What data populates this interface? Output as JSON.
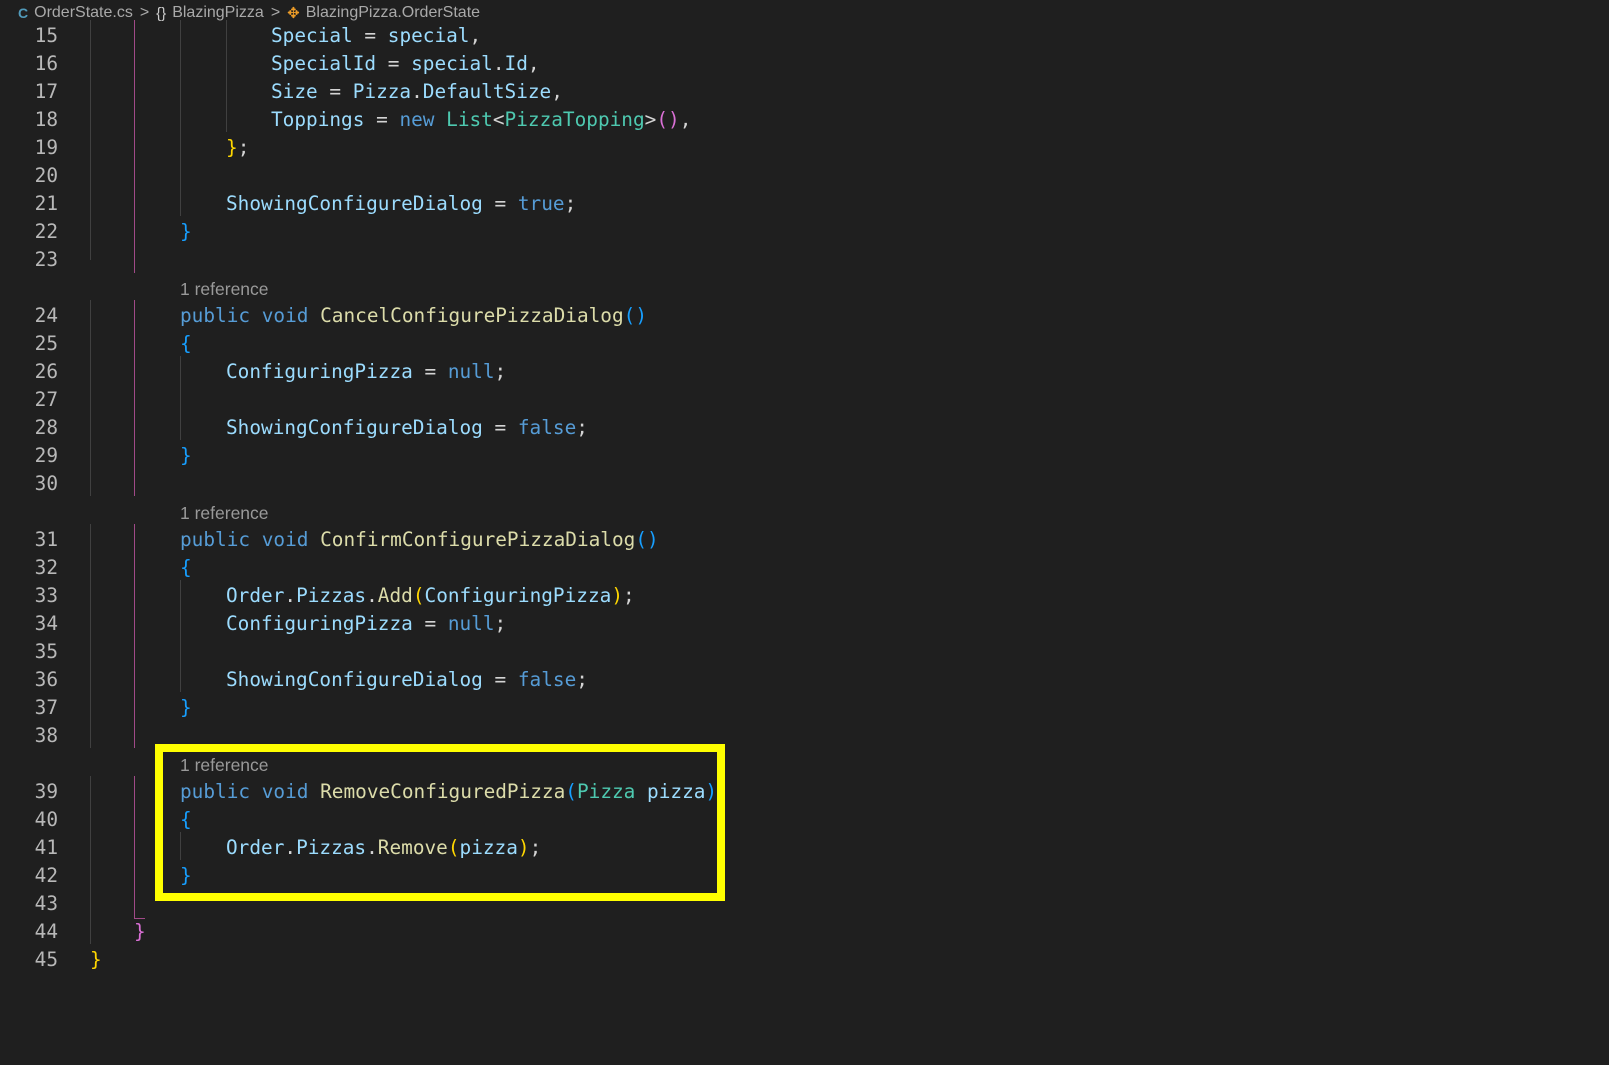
{
  "breadcrumb": {
    "file": "OrderState.cs",
    "namespace": "BlazingPizza",
    "class": "BlazingPizza.OrderState",
    "separator": ">",
    "file_icon": "csharp-file-icon",
    "namespace_icon": "namespace-braces-icon",
    "class_icon": "class-icon"
  },
  "colors": {
    "background": "#1f1f1f",
    "keyword": "#569cd6",
    "property": "#9cdcfe",
    "method": "#dcdcaa",
    "type": "#4ec9b0",
    "bracket_level1": "#ffd700",
    "bracket_level2": "#da70d6",
    "bracket_level3": "#179fff",
    "highlight_box": "#ffff00"
  },
  "code_lens": [
    "1 reference",
    "1 reference",
    "1 reference"
  ],
  "lines": [
    {
      "n": "15",
      "tokens": [
        [
          "prop",
          "Special"
        ],
        [
          "punc",
          " = "
        ],
        [
          "var",
          "special"
        ],
        [
          "punc",
          ","
        ]
      ]
    },
    {
      "n": "16",
      "tokens": [
        [
          "prop",
          "SpecialId"
        ],
        [
          "punc",
          " = "
        ],
        [
          "var",
          "special"
        ],
        [
          "punc",
          "."
        ],
        [
          "prop",
          "Id"
        ],
        [
          "punc",
          ","
        ]
      ]
    },
    {
      "n": "17",
      "tokens": [
        [
          "prop",
          "Size"
        ],
        [
          "punc",
          " = "
        ],
        [
          "prop",
          "Pizza"
        ],
        [
          "punc",
          "."
        ],
        [
          "prop",
          "DefaultSize"
        ],
        [
          "punc",
          ","
        ]
      ]
    },
    {
      "n": "18",
      "tokens": [
        [
          "prop",
          "Toppings"
        ],
        [
          "punc",
          " = "
        ],
        [
          "kw",
          "new"
        ],
        [
          "punc",
          " "
        ],
        [
          "type",
          "List"
        ],
        [
          "punc",
          "<"
        ],
        [
          "type",
          "PizzaTopping"
        ],
        [
          "punc",
          ">"
        ],
        [
          "b2",
          "()"
        ],
        [
          "punc",
          ","
        ]
      ]
    },
    {
      "n": "19",
      "tokens": [
        [
          "b1",
          "}"
        ],
        [
          "punc",
          ";"
        ]
      ]
    },
    {
      "n": "20",
      "tokens": []
    },
    {
      "n": "21",
      "tokens": [
        [
          "prop",
          "ShowingConfigureDialog"
        ],
        [
          "punc",
          " = "
        ],
        [
          "kw",
          "true"
        ],
        [
          "punc",
          ";"
        ]
      ]
    },
    {
      "n": "22",
      "tokens": [
        [
          "b3",
          "}"
        ]
      ]
    },
    {
      "n": "23",
      "tokens": []
    },
    {
      "n": "24",
      "tokens": [
        [
          "kw",
          "public"
        ],
        [
          "punc",
          " "
        ],
        [
          "kw",
          "void"
        ],
        [
          "punc",
          " "
        ],
        [
          "method",
          "CancelConfigurePizzaDialog"
        ],
        [
          "b3",
          "()"
        ]
      ]
    },
    {
      "n": "25",
      "tokens": [
        [
          "b3",
          "{"
        ]
      ]
    },
    {
      "n": "26",
      "tokens": [
        [
          "prop",
          "ConfiguringPizza"
        ],
        [
          "punc",
          " = "
        ],
        [
          "kw",
          "null"
        ],
        [
          "punc",
          ";"
        ]
      ]
    },
    {
      "n": "27",
      "tokens": []
    },
    {
      "n": "28",
      "tokens": [
        [
          "prop",
          "ShowingConfigureDialog"
        ],
        [
          "punc",
          " = "
        ],
        [
          "kw",
          "false"
        ],
        [
          "punc",
          ";"
        ]
      ]
    },
    {
      "n": "29",
      "tokens": [
        [
          "b3",
          "}"
        ]
      ]
    },
    {
      "n": "30",
      "tokens": []
    },
    {
      "n": "31",
      "tokens": [
        [
          "kw",
          "public"
        ],
        [
          "punc",
          " "
        ],
        [
          "kw",
          "void"
        ],
        [
          "punc",
          " "
        ],
        [
          "method",
          "ConfirmConfigurePizzaDialog"
        ],
        [
          "b3",
          "()"
        ]
      ]
    },
    {
      "n": "32",
      "tokens": [
        [
          "b3",
          "{"
        ]
      ]
    },
    {
      "n": "33",
      "tokens": [
        [
          "prop",
          "Order"
        ],
        [
          "punc",
          "."
        ],
        [
          "prop",
          "Pizzas"
        ],
        [
          "punc",
          "."
        ],
        [
          "method",
          "Add"
        ],
        [
          "b1",
          "("
        ],
        [
          "prop",
          "ConfiguringPizza"
        ],
        [
          "b1",
          ")"
        ],
        [
          "punc",
          ";"
        ]
      ]
    },
    {
      "n": "34",
      "tokens": [
        [
          "prop",
          "ConfiguringPizza"
        ],
        [
          "punc",
          " = "
        ],
        [
          "kw",
          "null"
        ],
        [
          "punc",
          ";"
        ]
      ]
    },
    {
      "n": "35",
      "tokens": []
    },
    {
      "n": "36",
      "tokens": [
        [
          "prop",
          "ShowingConfigureDialog"
        ],
        [
          "punc",
          " = "
        ],
        [
          "kw",
          "false"
        ],
        [
          "punc",
          ";"
        ]
      ]
    },
    {
      "n": "37",
      "tokens": [
        [
          "b3",
          "}"
        ]
      ]
    },
    {
      "n": "38",
      "tokens": []
    },
    {
      "n": "39",
      "tokens": [
        [
          "kw",
          "public"
        ],
        [
          "punc",
          " "
        ],
        [
          "kw",
          "void"
        ],
        [
          "punc",
          " "
        ],
        [
          "method",
          "RemoveConfiguredPizza"
        ],
        [
          "b3",
          "("
        ],
        [
          "type",
          "Pizza"
        ],
        [
          "punc",
          " "
        ],
        [
          "var",
          "pizza"
        ],
        [
          "b3",
          ")"
        ]
      ]
    },
    {
      "n": "40",
      "tokens": [
        [
          "b3",
          "{"
        ]
      ]
    },
    {
      "n": "41",
      "tokens": [
        [
          "prop",
          "Order"
        ],
        [
          "punc",
          "."
        ],
        [
          "prop",
          "Pizzas"
        ],
        [
          "punc",
          "."
        ],
        [
          "method",
          "Remove"
        ],
        [
          "b1",
          "("
        ],
        [
          "var",
          "pizza"
        ],
        [
          "b1",
          ")"
        ],
        [
          "punc",
          ";"
        ]
      ]
    },
    {
      "n": "42",
      "tokens": [
        [
          "b3",
          "}"
        ]
      ]
    },
    {
      "n": "43",
      "tokens": []
    },
    {
      "n": "44",
      "tokens": [
        [
          "b2",
          "}"
        ]
      ]
    },
    {
      "n": "45",
      "tokens": [
        [
          "b1",
          "}"
        ]
      ]
    }
  ]
}
